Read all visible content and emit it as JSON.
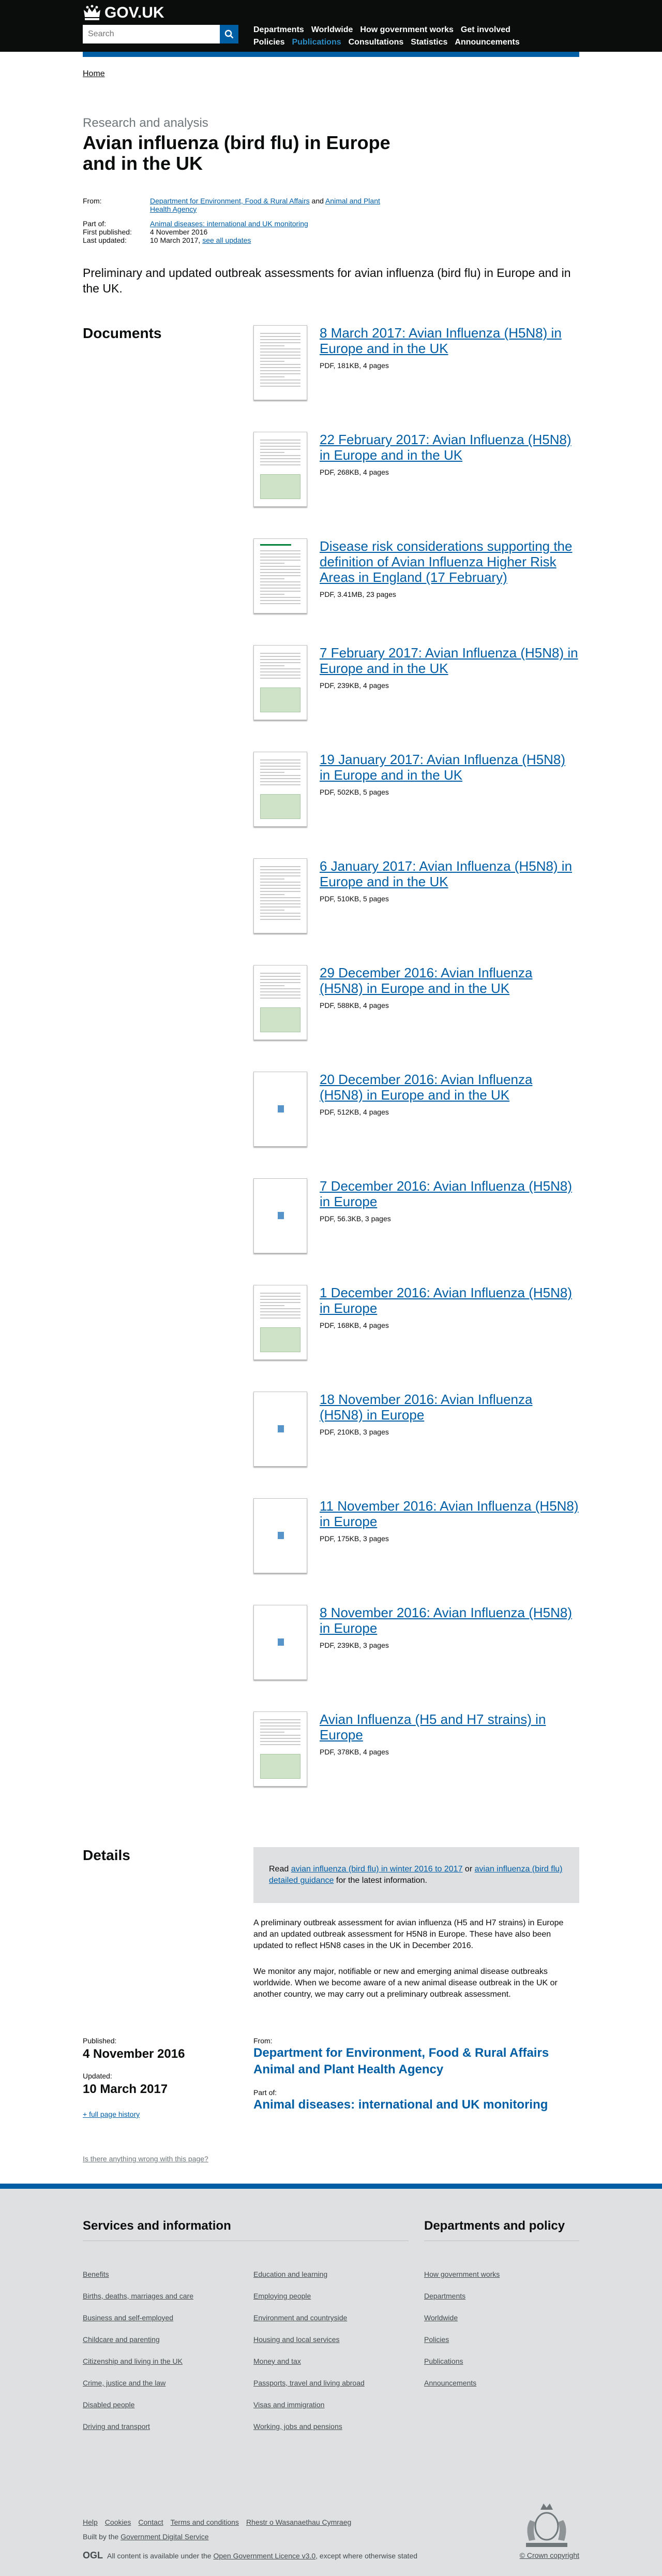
{
  "header": {
    "logo_text": "GOV.UK",
    "search_placeholder": "Search",
    "nav": [
      "Departments",
      "Worldwide",
      "How government works",
      "Get involved",
      "Policies",
      "Publications",
      "Consultations",
      "Statistics",
      "Announcements"
    ],
    "active_nav": "Publications"
  },
  "breadcrumb": "Home",
  "page": {
    "caption": "Research and analysis",
    "title": "Avian influenza (bird flu) in Europe and in the UK",
    "from_label": "From:",
    "from_org1": "Department for Environment, Food & Rural Affairs",
    "from_and": "and",
    "from_org2": "Animal and Plant Health Agency",
    "part_of_label": "Part of:",
    "part_of": "Animal diseases: international and UK monitoring",
    "first_published_label": "First published:",
    "first_published": "4 November 2016",
    "last_updated_label": "Last updated:",
    "last_updated": "10 March 2017,",
    "see_all_updates": "see all updates",
    "description": "Preliminary and updated outbreak assessments for avian influenza (bird flu) in Europe and in the UK."
  },
  "documents_heading": "Documents",
  "documents": [
    {
      "title": "8 March 2017: Avian Influenza (H5N8) in Europe and in the UK",
      "meta": "PDF, 181KB, 4 pages",
      "thumb": "text"
    },
    {
      "title": "22 February 2017: Avian Influenza (H5N8) in Europe and in the UK",
      "meta": "PDF, 268KB, 4 pages",
      "thumb": "map"
    },
    {
      "title": "Disease risk considerations supporting the definition of Avian Influenza Higher Risk Areas in England (17 February)",
      "meta": "PDF, 3.41MB, 23 pages",
      "thumb": "green"
    },
    {
      "title": "7 February 2017: Avian Influenza (H5N8) in Europe and in the UK",
      "meta": "PDF, 239KB, 4 pages",
      "thumb": "map"
    },
    {
      "title": "19 January 2017: Avian Influenza (H5N8) in Europe and in the UK",
      "meta": "PDF, 502KB, 5 pages",
      "thumb": "map"
    },
    {
      "title": "6 January 2017: Avian Influenza (H5N8) in Europe and in the UK",
      "meta": "PDF, 510KB, 5 pages",
      "thumb": "text"
    },
    {
      "title": "29 December 2016: Avian Influenza (H5N8) in Europe and in the UK",
      "meta": "PDF, 588KB, 4 pages",
      "thumb": "map"
    },
    {
      "title": "20 December 2016: Avian Influenza (H5N8) in Europe and in the UK",
      "meta": "PDF, 512KB, 4 pages",
      "thumb": "blank"
    },
    {
      "title": "7 December 2016: Avian Influenza (H5N8) in Europe",
      "meta": "PDF, 56.3KB, 3 pages",
      "thumb": "blank"
    },
    {
      "title": "1 December 2016: Avian Influenza (H5N8) in Europe",
      "meta": "PDF, 168KB, 4 pages",
      "thumb": "map"
    },
    {
      "title": "18 November 2016: Avian Influenza (H5N8) in Europe",
      "meta": "PDF, 210KB, 3 pages",
      "thumb": "blank"
    },
    {
      "title": "11 November 2016: Avian Influenza (H5N8) in Europe",
      "meta": "PDF, 175KB, 3 pages",
      "thumb": "blank"
    },
    {
      "title": "8 November 2016: Avian Influenza (H5N8) in Europe",
      "meta": "PDF, 239KB, 3 pages",
      "thumb": "blank"
    },
    {
      "title": "Avian Influenza (H5 and H7 strains) in Europe",
      "meta": "PDF, 378KB, 4 pages",
      "thumb": "map"
    }
  ],
  "details": {
    "heading": "Details",
    "callout_pre": "Read",
    "callout_link1": "avian influenza (bird flu) in winter 2016 to 2017",
    "callout_or": "or",
    "callout_link2": "avian influenza (bird flu) detailed guidance",
    "callout_post": "for the latest information.",
    "para1": "A preliminary outbreak assessment for avian influenza (H5 and H7 strains) in Europe and an updated outbreak assessment for H5N8 in Europe. These have also been updated to reflect H5N8 cases in the UK in December 2016.",
    "para2": "We monitor any major, notifiable or new and emerging animal disease outbreaks worldwide. When we become aware of a new animal disease outbreak in the UK or another country, we may carry out a preliminary outbreak assessment."
  },
  "publisher": {
    "published_label": "Published:",
    "published": "4 November 2016",
    "updated_label": "Updated:",
    "updated": "10 March 2017",
    "history_link": "+ full page history",
    "from_label": "From:",
    "org1": "Department for Environment, Food & Rural Affairs",
    "org2": "Animal and Plant Health Agency",
    "part_of_label": "Part of:",
    "part_of": "Animal diseases: international and UK monitoring"
  },
  "report_link": "Is there anything wrong with this page?",
  "footer": {
    "services_heading": "Services and information",
    "departments_heading": "Departments and policy",
    "services_col1": [
      "Benefits",
      "Births, deaths, marriages and care",
      "Business and self-employed",
      "Childcare and parenting",
      "Citizenship and living in the UK",
      "Crime, justice and the law",
      "Disabled people",
      "Driving and transport"
    ],
    "services_col2": [
      "Education and learning",
      "Employing people",
      "Environment and countryside",
      "Housing and local services",
      "Money and tax",
      "Passports, travel and living abroad",
      "Visas and immigration",
      "Working, jobs and pensions"
    ],
    "departments": [
      "How government works",
      "Departments",
      "Worldwide",
      "Policies",
      "Publications",
      "Announcements"
    ],
    "meta_links": [
      "Help",
      "Cookies",
      "Contact",
      "Terms and conditions",
      "Rhestr o Wasanaethau Cymraeg"
    ],
    "built_pre": "Built by the",
    "built_link": "Government Digital Service",
    "ogl": "OGL",
    "licence_pre": "All content is available under the",
    "licence_link": "Open Government Licence v3.0",
    "licence_post": ", except where otherwise stated",
    "copyright": "© Crown copyright"
  }
}
